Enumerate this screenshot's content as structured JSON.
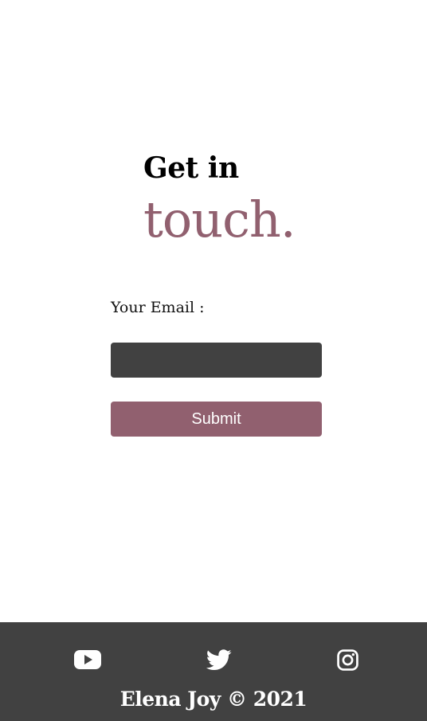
{
  "heading": {
    "line1": "Get in",
    "line2": "touch."
  },
  "form": {
    "email_label": "Your Email :",
    "email_value": "",
    "submit_label": "Submit"
  },
  "footer": {
    "social": [
      {
        "name": "youtube-icon"
      },
      {
        "name": "twitter-icon"
      },
      {
        "name": "instagram-icon"
      }
    ],
    "copyright": "Elena Joy © 2021"
  },
  "colors": {
    "accent": "#91606f",
    "dark": "#414141",
    "background": "#ffffff"
  }
}
